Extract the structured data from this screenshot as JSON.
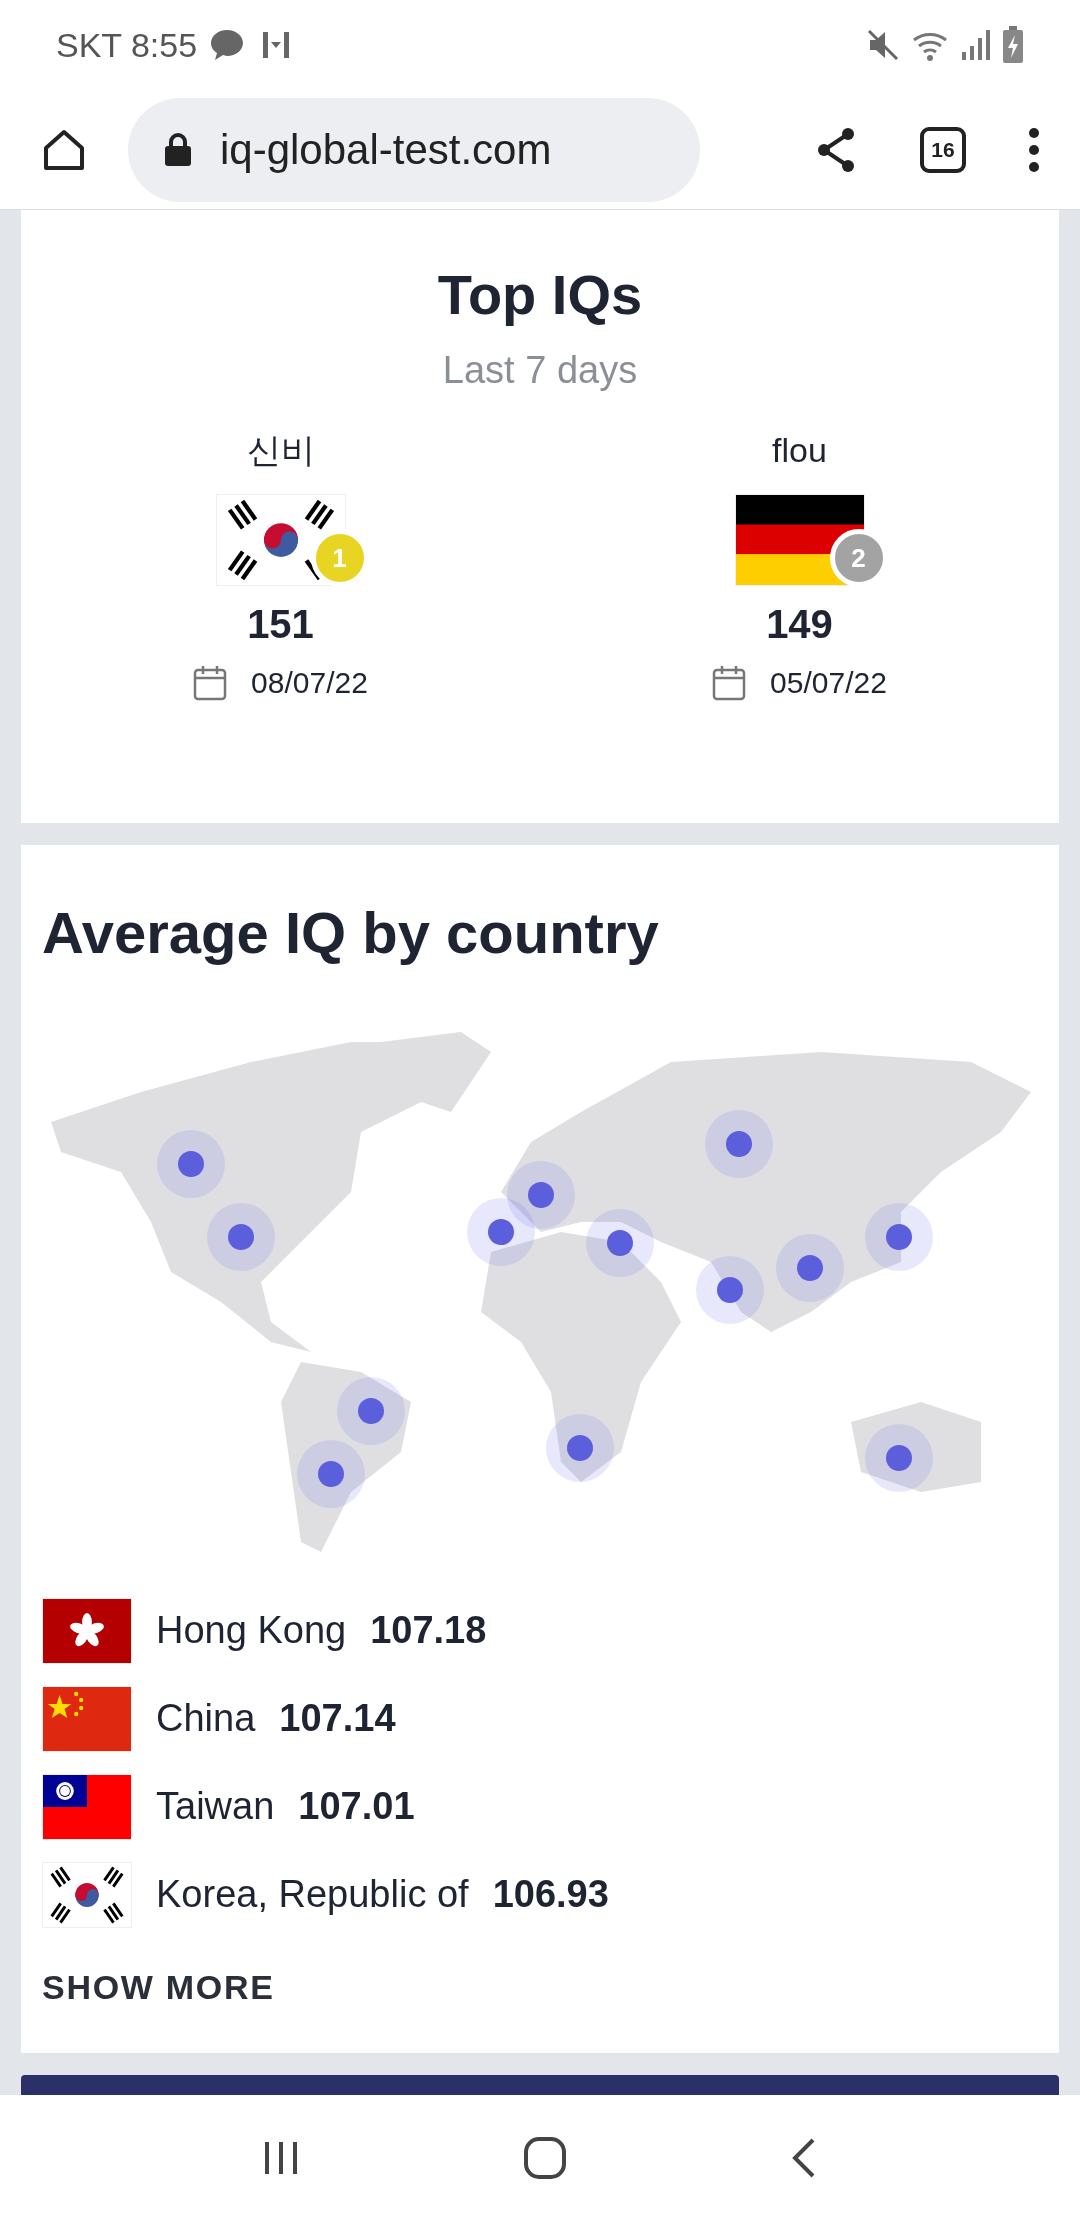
{
  "status_bar": {
    "time": "SKT 8:55"
  },
  "browser": {
    "url": "iq-global-test.com",
    "tab_count": "16"
  },
  "top_iqs": {
    "title": "Top IQs",
    "subtitle": "Last 7 days",
    "entries": [
      {
        "name": "신비",
        "kind": "korea",
        "rank": "1",
        "color": "#e8d422",
        "iq": "151",
        "date": "08/07/22"
      },
      {
        "name": "flou",
        "kind": "germany",
        "rank": "2",
        "color": "#a3a3a3",
        "iq": "149",
        "date": "05/07/22"
      }
    ]
  },
  "average": {
    "title": "Average IQ by country",
    "countries": [
      {
        "kind": "hongkong",
        "name": "Hong Kong",
        "score": "107.18"
      },
      {
        "kind": "china",
        "name": "China",
        "score": "107.14"
      },
      {
        "kind": "taiwan",
        "name": "Taiwan",
        "score": "107.01"
      },
      {
        "kind": "korea",
        "name": "Korea, Republic of",
        "score": "106.93"
      }
    ],
    "show_more": "SHOW MORE"
  }
}
